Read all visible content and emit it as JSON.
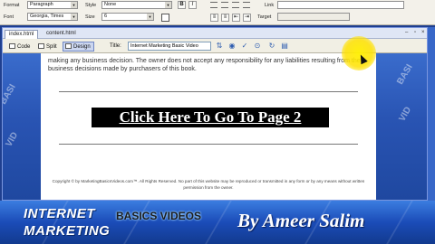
{
  "properties": {
    "format_label": "Format",
    "format_value": "Paragraph",
    "style_label": "Style",
    "style_value": "None",
    "font_label": "Font",
    "font_value": "Georgia, Times",
    "size_label": "Size",
    "size_value": "6",
    "bold": "B",
    "italic": "I",
    "link_label": "Link",
    "target_label": "Target"
  },
  "document": {
    "tabs": [
      "index.html",
      "content.html"
    ],
    "views": [
      "Code",
      "Split",
      "Design"
    ],
    "title_label": "Title:",
    "title_value": "Internet Marketing Basic Video"
  },
  "page": {
    "body_text": "making any business decision. The owner does not accept any responsibility for any liabilities resulting from the business decisions made by purchasers of this book.",
    "cta_text": "Click Here To Go To Page 2",
    "copyright": "Copyright © by MarketingBasicsVideos.com™. All Rights Reserved. No part of this website may be reproduced or transmitted in any form or by any means without written permission from the owner."
  },
  "banner": {
    "line1": "INTERNET",
    "line2": "MARKETING",
    "basics": "BASICS VIDEOS",
    "byline": "By Ameer Salim"
  },
  "colors": {
    "banner_blue": "#1b4cb8",
    "highlight": "#ffe100"
  }
}
